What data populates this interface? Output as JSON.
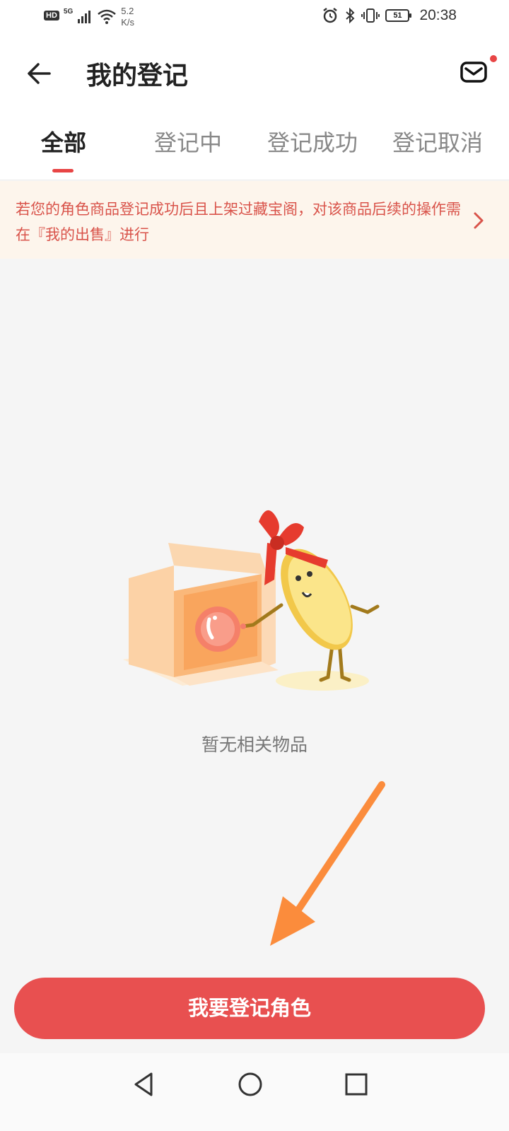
{
  "status_bar": {
    "hd_badge": "HD",
    "network_type": "5G",
    "speed_value": "5.2",
    "speed_unit": "K/s",
    "battery_level": "51",
    "time": "20:38",
    "icons": [
      "signal-icon",
      "wifi-icon",
      "alarm-icon",
      "bluetooth-icon",
      "vibrate-icon",
      "battery-icon"
    ]
  },
  "header": {
    "title": "我的登记",
    "back_icon": "arrow-left-icon",
    "mail_icon": "mail-icon",
    "has_unread": true
  },
  "tabs": [
    {
      "label": "全部",
      "active": true
    },
    {
      "label": "登记中",
      "active": false
    },
    {
      "label": "登记成功",
      "active": false
    },
    {
      "label": "登记取消",
      "active": false
    }
  ],
  "notice": {
    "text": "若您的角色商品登记成功后且上架过藏宝阁，对该商品后续的操作需在『我的出售』进行",
    "icon": "chevron-right-icon"
  },
  "empty_state": {
    "message": "暂无相关物品",
    "illustration": "coin-mascot-box-illustration"
  },
  "cta": {
    "label": "我要登记角色"
  },
  "nav_bar": {
    "icons": [
      "nav-back-icon",
      "nav-home-icon",
      "nav-recent-icon"
    ]
  },
  "colors": {
    "accent": "#e84545",
    "cta": "#e85050",
    "notice_bg": "#fdf5ec",
    "notice_text": "#d9534a",
    "page_bg": "#f5f5f5"
  }
}
